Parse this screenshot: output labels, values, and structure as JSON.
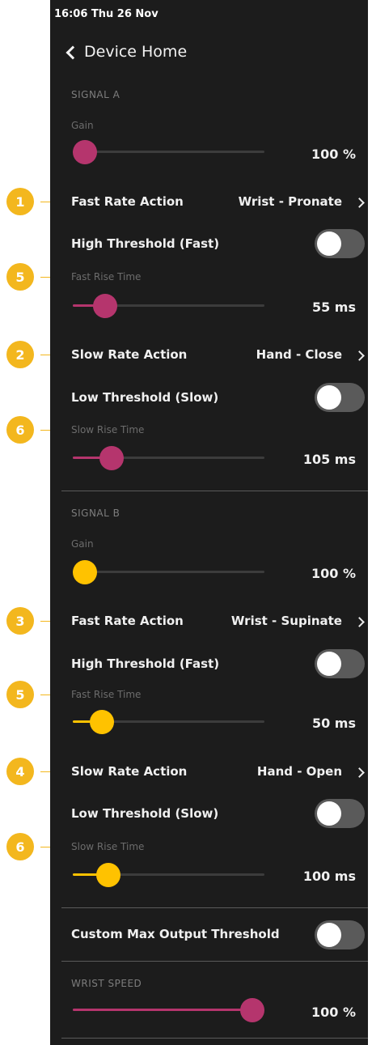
{
  "status_bar": {
    "time_date": "16:06  Thu 26 Nov"
  },
  "nav": {
    "back_label": "Device Home"
  },
  "signal_a": {
    "header": "SIGNAL A",
    "gain": {
      "label": "Gain",
      "value": "100 %",
      "level": 0.0
    },
    "fast_rate_action": {
      "label": "Fast Rate Action",
      "value": "Wrist - Pronate"
    },
    "high_threshold": {
      "label": "High Threshold (Fast)",
      "on": false
    },
    "fast_rise_time": {
      "label": "Fast Rise Time",
      "value": "55 ms",
      "level": 0.12
    },
    "slow_rate_action": {
      "label": "Slow Rate Action",
      "value": "Hand - Close"
    },
    "low_threshold": {
      "label": "Low Threshold (Slow)",
      "on": false
    },
    "slow_rise_time": {
      "label": "Slow Rise Time",
      "value": "105 ms",
      "level": 0.16
    }
  },
  "signal_b": {
    "header": "SIGNAL B",
    "gain": {
      "label": "Gain",
      "value": "100 %",
      "level": 0.0
    },
    "fast_rate_action": {
      "label": "Fast Rate Action",
      "value": "Wrist - Supinate"
    },
    "high_threshold": {
      "label": "High Threshold (Fast)",
      "on": false
    },
    "fast_rise_time": {
      "label": "Fast Rise Time",
      "value": "50 ms",
      "level": 0.1
    },
    "slow_rate_action": {
      "label": "Slow Rate Action",
      "value": "Hand - Open"
    },
    "low_threshold": {
      "label": "Low Threshold (Slow)",
      "on": false
    },
    "slow_rise_time": {
      "label": "Slow Rise Time",
      "value": "100 ms",
      "level": 0.14
    }
  },
  "custom_max_output": {
    "label": "Custom Max Output Threshold",
    "on": false
  },
  "wrist_speed": {
    "header": "WRIST SPEED",
    "value": "100 %",
    "level": 1.0
  },
  "callouts": [
    "1",
    "5",
    "2",
    "6",
    "3",
    "5",
    "4",
    "6"
  ],
  "colors": {
    "signal_a_accent": "#b5356d",
    "signal_b_accent": "#ffc200",
    "callout": "#f3b71e",
    "background": "#1c1c1c"
  }
}
